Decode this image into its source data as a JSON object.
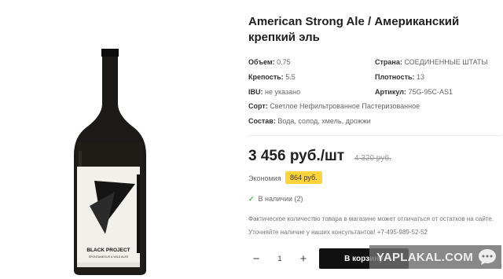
{
  "product": {
    "title": "American Strong Ale / Американский крепкий эль",
    "label_brand": "BLACK PROJECT",
    "label_tagline": "SPONTANEOUS & WILD ALES"
  },
  "specs": {
    "volume": {
      "key": "Объем:",
      "value": "0.75"
    },
    "country": {
      "key": "Страна:",
      "value": "СОЕДИНЕННЫЕ ШТАТЫ"
    },
    "strength": {
      "key": "Крепость:",
      "value": "5.5"
    },
    "density": {
      "key": "Плотность:",
      "value": "13"
    },
    "ibu": {
      "key": "IBU:",
      "value": "не указано"
    },
    "article": {
      "key": "Артикул:",
      "value": "75G-95C-AS1"
    },
    "variety": {
      "key": "Сорт:",
      "value": "Светлое Нефильтрованное Пастеризованное"
    },
    "composition": {
      "key": "Состав:",
      "value": "Вода, солод, хмель, дрожжи"
    }
  },
  "pricing": {
    "price": "3 456 руб./шт",
    "old_price": "4 320 руб.",
    "economy_label": "Экономия",
    "economy_value": "864 руб."
  },
  "stock": {
    "text": "В наличии (2)"
  },
  "note": {
    "text": "Фактическое количество товара в магазине может отличаться от остатков на сайте. Уточняйте наличие у наших консультантов! +7-495-989-52-52"
  },
  "cart": {
    "quantity": "1",
    "minus": "−",
    "plus": "+",
    "button_label": "В корзину"
  },
  "watermark": {
    "text": "YAPLAKAL.COM"
  }
}
